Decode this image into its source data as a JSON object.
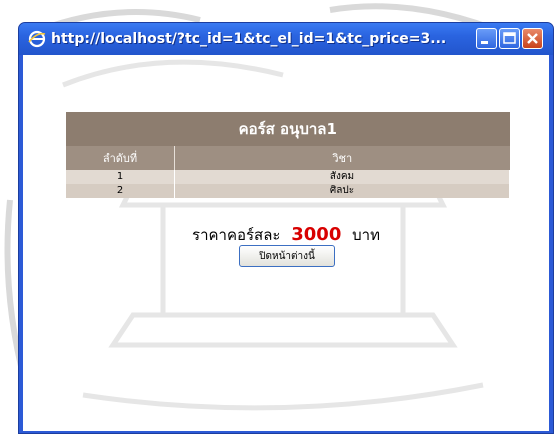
{
  "window": {
    "title": "http://localhost/?tc_id=1&tc_el_id=1&tc_price=3..."
  },
  "course": {
    "title": "คอร์ส อนุบาล1",
    "columns": [
      "ลำดับที่",
      "วิชา"
    ],
    "rows": [
      {
        "no": "1",
        "subject": "สังคม"
      },
      {
        "no": "2",
        "subject": "ศิลปะ"
      }
    ]
  },
  "price": {
    "prefix": "ราคาคอร์สละ",
    "value": "3000",
    "unit": "บาท"
  },
  "close_button": {
    "label": "ปิดหน้าต่างนี้"
  },
  "colors": {
    "title_bar": "#2a64e0",
    "table_header": "#8d7d6f",
    "price_value": "#d80000"
  },
  "icons": [
    "ie-icon",
    "minimize-icon",
    "maximize-icon",
    "close-icon"
  ]
}
